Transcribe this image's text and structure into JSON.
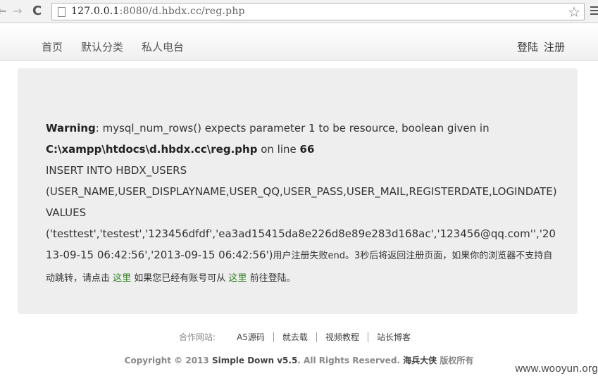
{
  "browser": {
    "back_glyph": "←",
    "forward_glyph": "→",
    "reload_glyph": "C",
    "url_host": "127.0.0.1",
    "url_rest": ":8080/d.hbdx.cc/reg.php",
    "star_glyph": "☆"
  },
  "nav": {
    "left_items": [
      "首页",
      "默认分类",
      "私人电台"
    ],
    "right_items": [
      "登陆",
      "注册"
    ]
  },
  "message": {
    "warning_label": "Warning",
    "warning_text": ": mysql_num_rows() expects parameter 1 to be resource, boolean given in",
    "file_path": "C:\\xampp\\htdocs\\d.hbdx.cc\\reg.php",
    "on_line": " on line ",
    "line_number": "66",
    "sql_line1": "INSERT INTO HBDX_USERS",
    "sql_line2": "(USER_NAME,USER_DISPLAYNAME,USER_QQ,USER_PASS,USER_MAIL,REGISTERDATE,LOGINDATE)",
    "sql_line3": "VALUES",
    "sql_values": "('testtest','testest','123456dfdf','ea3ad15415da8e226d8e89e283d168ac','123456@qq.com'','2013-09-15 06:42:56','2013-09-15 06:42:56')",
    "cn_fail": "用户注册失败end。3秒后将返回注册页面，如果你的浏览器不支持自动跳转，请点击 ",
    "link_here_1": "这里",
    "cn_middle": " 如果您已经有账号可从 ",
    "link_here_2": "这里",
    "cn_end": " 前往登陆。"
  },
  "footer": {
    "partners_label": "合作网站:",
    "partners": [
      "A5源码",
      "就去载",
      "视频教程",
      "站长博客"
    ],
    "copyright_prefix": "Copyright © 2013 ",
    "copyright_product": "Simple Down v5.5",
    "copyright_mid": ". All Rights Reserved. ",
    "copyright_owner": "海兵大侠",
    "copyright_suffix": " 版权所有"
  },
  "watermark": "www.wooyun.org"
}
